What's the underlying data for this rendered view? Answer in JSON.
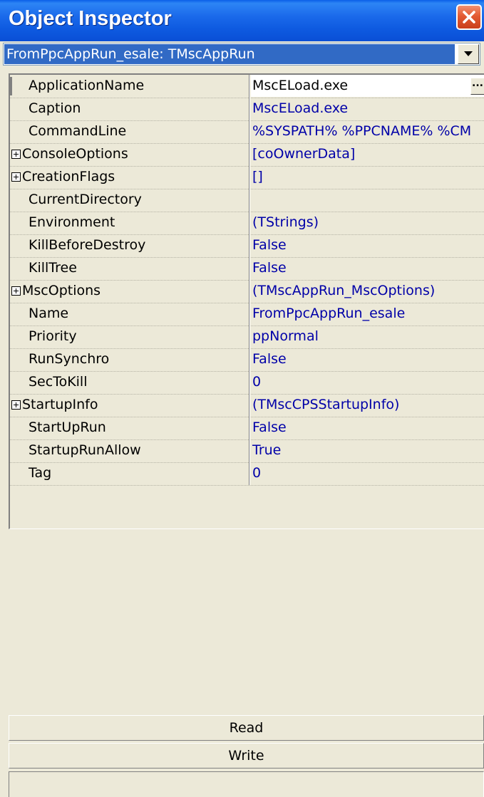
{
  "window": {
    "title": "Object Inspector"
  },
  "selector": {
    "value": "FromPpcAppRun_esale: TMscAppRun"
  },
  "properties": [
    {
      "name": "ApplicationName",
      "value": "MscELoad.exe",
      "expandable": false,
      "selected": true,
      "has_ellipsis": true,
      "ellipsis_label": "..."
    },
    {
      "name": "Caption",
      "value": "MscELoad.exe",
      "expandable": false
    },
    {
      "name": "CommandLine",
      "value": "%SYSPATH% %PPCNAME% %CM",
      "expandable": false
    },
    {
      "name": "ConsoleOptions",
      "value": "[coOwnerData]",
      "expandable": true
    },
    {
      "name": "CreationFlags",
      "value": "[]",
      "expandable": true
    },
    {
      "name": "CurrentDirectory",
      "value": "",
      "expandable": false
    },
    {
      "name": "Environment",
      "value": "(TStrings)",
      "expandable": false
    },
    {
      "name": "KillBeforeDestroy",
      "value": "False",
      "expandable": false
    },
    {
      "name": "KillTree",
      "value": "False",
      "expandable": false
    },
    {
      "name": "MscOptions",
      "value": "(TMscAppRun_MscOptions)",
      "expandable": true
    },
    {
      "name": "Name",
      "value": "FromPpcAppRun_esale",
      "expandable": false
    },
    {
      "name": "Priority",
      "value": "ppNormal",
      "expandable": false
    },
    {
      "name": "RunSynchro",
      "value": "False",
      "expandable": false
    },
    {
      "name": "SecToKill",
      "value": "0",
      "expandable": false
    },
    {
      "name": "StartupInfo",
      "value": "(TMscCPSStartupInfo)",
      "expandable": true
    },
    {
      "name": "StartUpRun",
      "value": "False",
      "expandable": false
    },
    {
      "name": "StartupRunAllow",
      "value": "True",
      "expandable": false
    },
    {
      "name": "Tag",
      "value": "0",
      "expandable": false
    }
  ],
  "buttons": {
    "read": "Read",
    "write": "Write"
  },
  "colors": {
    "titlebar": "#0a5fe8",
    "selection": "#316ac5",
    "value_text": "#0000a8",
    "window_bg": "#ece9d8"
  },
  "icons": {
    "close": "close-icon",
    "dropdown": "chevron-down-icon",
    "expander": "plus-box-icon"
  }
}
